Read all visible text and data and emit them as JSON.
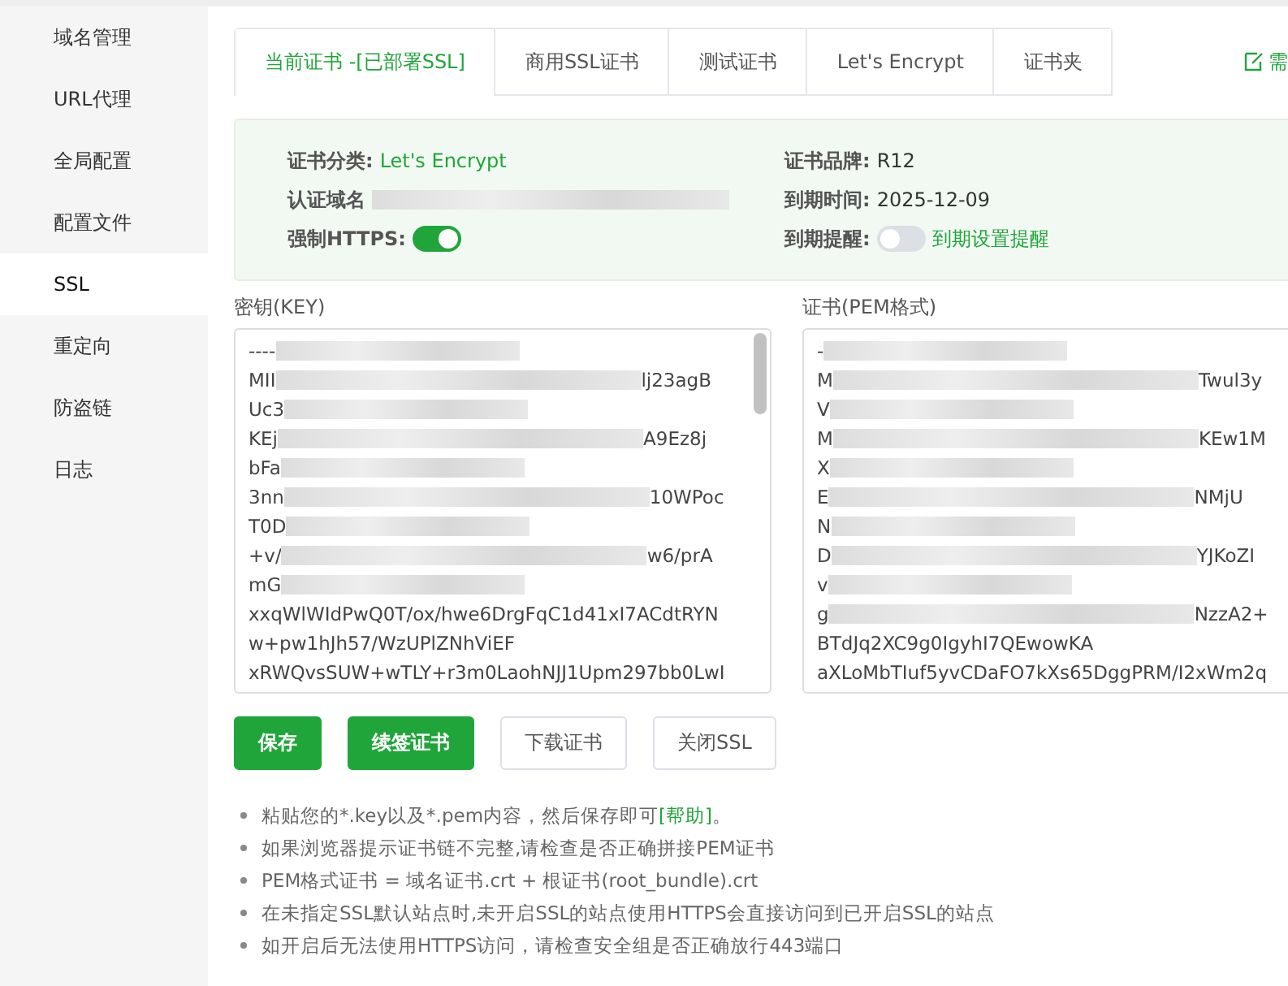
{
  "sidebar": {
    "items": [
      {
        "label": "域名管理",
        "selected": false
      },
      {
        "label": "URL代理",
        "selected": false
      },
      {
        "label": "全局配置",
        "selected": false
      },
      {
        "label": "配置文件",
        "selected": false
      },
      {
        "label": "SSL",
        "selected": true
      },
      {
        "label": "重定向",
        "selected": false
      },
      {
        "label": "防盗链",
        "selected": false
      },
      {
        "label": "日志",
        "selected": false
      }
    ]
  },
  "tabs": [
    {
      "label": "当前证书 -[已部署SSL]",
      "selected": true
    },
    {
      "label": "商用SSL证书",
      "selected": false
    },
    {
      "label": "测试证书",
      "selected": false
    },
    {
      "label": "Let's Encrypt",
      "selected": false
    },
    {
      "label": "证书夹",
      "selected": false
    }
  ],
  "header_link": "需",
  "info": {
    "category_label": "证书分类:",
    "category": "Let's Encrypt",
    "domain_label": "认证域名",
    "force_https_label": "强制HTTPS:",
    "force_https": true,
    "brand_label": "证书品牌:",
    "brand": "R12",
    "expiry_label": "到期时间:",
    "expiry": "2025-12-09",
    "reminder_label": "到期提醒:",
    "reminder": false,
    "reminder_link": "到期设置提醒"
  },
  "key": {
    "label": "密钥(KEY)",
    "lines": [
      {
        "start": "----"
      },
      {
        "start": "MII",
        "end": "lj23agB"
      },
      {
        "start": "Uc3"
      },
      {
        "start": "KEj",
        "end": "A9Ez8j"
      },
      {
        "start": "bFa"
      },
      {
        "start": "3nn",
        "end": "10WPoc"
      },
      {
        "start": "T0D"
      },
      {
        "start": "+v/",
        "end": "w6/prA"
      },
      {
        "start": "mG"
      },
      {
        "start": "xxqWlWIdPwQ0T/ox/hwe6DrgFqC1d41xI7ACdtRYN"
      },
      {
        "start": "w+pw1hJh57/WzUPlZNhViEF"
      },
      {
        "start": "xRWQvsSUW+wTLY+r3m0LaohNJJ1Upm297bb0LwI"
      }
    ]
  },
  "cert": {
    "label": "证书(PEM格式)",
    "lines": [
      {
        "start": "-"
      },
      {
        "start": "M",
        "end": "Twul3y"
      },
      {
        "start": "V"
      },
      {
        "start": "M",
        "end": "KEw1M"
      },
      {
        "start": "X"
      },
      {
        "start": "E",
        "end": "NMjU"
      },
      {
        "start": "N"
      },
      {
        "start": "D",
        "end": "YJKoZI"
      },
      {
        "start": "v"
      },
      {
        "start": "g",
        "end": "NzzA2+"
      },
      {
        "start": "BTdJq2XC9g0IgyhI7QEwowKA"
      },
      {
        "start": "aXLoMbTIuf5yvCDaFO7kXs65DggPRM/I2xWm2q"
      }
    ]
  },
  "buttons": [
    {
      "label": "保存",
      "kind": "primary"
    },
    {
      "label": "续签证书",
      "kind": "primary"
    },
    {
      "label": "下载证书",
      "kind": "default"
    },
    {
      "label": "关闭SSL",
      "kind": "default"
    }
  ],
  "notes": [
    {
      "text": "粘贴您的*.key以及*.pem内容，然后保存即可",
      "link": "[帮助]",
      "after": "。"
    },
    {
      "text": "如果浏览器提示证书链不完整,请检查是否正确拼接PEM证书"
    },
    {
      "text": "PEM格式证书 = 域名证书.crt + 根证书(root_bundle).crt"
    },
    {
      "text": "在未指定SSL默认站点时,未开启SSL的站点使用HTTPS会直接访问到已开启SSL的站点"
    },
    {
      "text": "如开启后无法使用HTTPS访问，请检查安全组是否正确放行443端口"
    }
  ]
}
